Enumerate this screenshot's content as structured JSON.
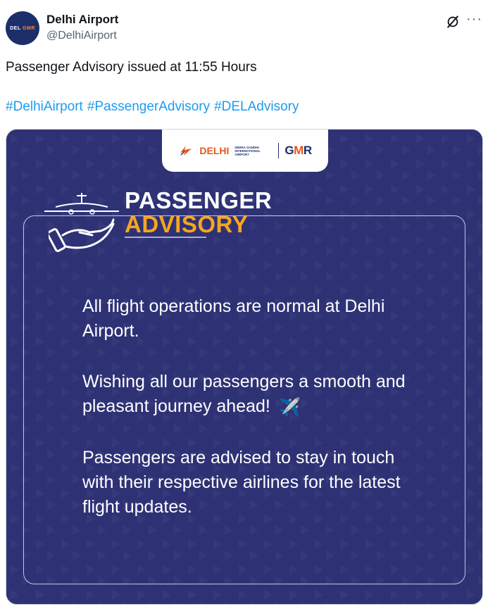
{
  "account": {
    "avatar_text_main": "DEL",
    "avatar_text_accent": "GMR",
    "name": "Delhi Airport",
    "handle": "@DelhiAirport"
  },
  "icons": {
    "grok": "grok-icon",
    "more": "more-options-icon",
    "plane": "airplane-icon",
    "hand": "hand-icon"
  },
  "tweet": {
    "text": "Passenger Advisory issued at 11:55 Hours",
    "hashtags": [
      "#DelhiAirport",
      "#PassengerAdvisory",
      "#DELAdvisory"
    ]
  },
  "card": {
    "logo": {
      "delhi": "DELHI",
      "delhi_sub": "INDIRA GANDHI INTERNATIONAL AIRPORT",
      "gmr_a": "G",
      "gmr_b": "M",
      "gmr_c": "R"
    },
    "title_line1": "PASSENGER",
    "title_line2": "ADVISORY",
    "paragraph1": "All flight operations are normal at Delhi Airport.",
    "paragraph2": "Wishing all our passengers a smooth and pleasant journey ahead!",
    "paragraph2_emoji": "✈️",
    "paragraph3": "Passengers are advised to stay in touch with their respective airlines for the latest flight updates."
  },
  "colors": {
    "card_bg": "#2e3275",
    "accent_orange": "#f7a51f",
    "link_blue": "#1d9bf0"
  }
}
